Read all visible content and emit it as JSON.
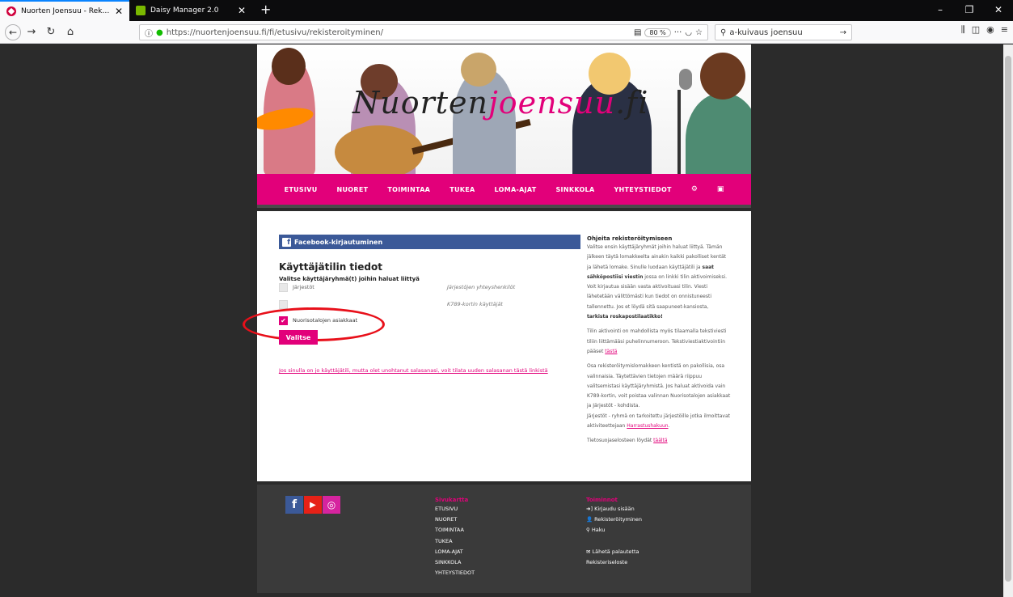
{
  "browser": {
    "tabs": [
      {
        "title": "Nuorten Joensuu - Rekisteröitym",
        "active": true
      },
      {
        "title": "Daisy Manager 2.0",
        "active": false
      }
    ],
    "new_tab": "+",
    "window_controls": {
      "minimize": "–",
      "restore": "❐",
      "close": "✕"
    },
    "url": "https://nuortenjoensuu.fi/fi/etusivu/rekisteroityminen/",
    "zoom": "80 %",
    "search_query": "a-kuivaus joensuu"
  },
  "site": {
    "logo_part1": "Nuorten",
    "logo_part2": "joensuu",
    "logo_part3": ".fi",
    "menu": [
      "ETUSIVU",
      "NUORET",
      "TOIMINTAA",
      "TUKEA",
      "LOMA-AJAT",
      "SINKKOLA",
      "YHTEYSTIEDOT"
    ],
    "accent_color": "#e2007a"
  },
  "form": {
    "facebook_button": "Facebook-kirjautuminen",
    "heading": "Käyttäjätilin tiedot",
    "group_prompt": "Valitse käyttäjäryhmä(t) joihin haluat liittyä",
    "groups": [
      {
        "label": "Järjestöt",
        "desc": "Järjestöjen yhteyshenkilöt",
        "checked": false
      },
      {
        "label": "",
        "desc": "K789-kortin käyttäjät",
        "checked": false
      },
      {
        "label": "Nuorisotalojen asiakkaat",
        "desc": "",
        "checked": true
      }
    ],
    "submit": "Valitse",
    "forgot_link": "Jos sinulla on jo käyttäjätili, mutta olet unohtanut salasanasi, voit tilata uuden salasanan tästä linkistä"
  },
  "help": {
    "title": "Ohjeita rekisteröitymiseen",
    "p1": "Valitse ensin käyttäjäryhmät joihin haluat liittyä. Tämän jälkeen täytä lomakkeelta ainakin kaikki pakolliset kentät ja lähetä lomake. Sinulle luodaan käyttäjätili ja ",
    "p1_bold1": "saat sähköpostiisi viestin",
    "p1_b": " jossa on linkki tilin aktivoimiseksi. Voit kirjautua sisään vasta aktivoituasi tilin. Viesti lähetetään välittömästi kun tiedot on onnistuneesti tallennettu. Jos et löydä sitä saapuneet-kansiosta, ",
    "p1_bold2": "tarkista roskapostilaatikko!",
    "p2": "Tilin aktivointi on mahdollista myös tilaamalla tekstiviesti tiliin liittämääsi puhelinnumeroon. Tekstiviestiaktivointiin pääset ",
    "p2_link": "tästä",
    "p3a": "Osa rekisteröitymislomakkeen kentistä on pakollisia, osa valinnaisia. Täytettävien tietojen määrä riippuu valitsemistasi käyttäjäryhmistä. Jos haluat aktivoida vain K789-kortin, voit poistaa valinnan Nuorisotalojen asiakkaat ja Järjestöt - kohdista.",
    "p3b": "Järjestöt - ryhmä on tarkoitettu järjestöille jotka ilmoittavat aktiviteettejaan ",
    "p3_link": "Harrastushakuun",
    "p4": "Tietosuojaselosteen löydät ",
    "p4_link": "täältä"
  },
  "footer": {
    "col1_title": "Sivukartta",
    "col1_items": [
      "ETUSIVU",
      "NUORET",
      "TOIMINTAA",
      "TUKEA",
      "LOMA-AJAT",
      "SINKKOLA",
      "YHTEYSTIEDOT"
    ],
    "col2_title": "Toiminnot",
    "login": "Kirjaudu sisään",
    "register": "Rekisteröityminen",
    "search": "Haku",
    "feedback": "Lähetä palautetta",
    "privacy": "Rekisteriseloste"
  }
}
